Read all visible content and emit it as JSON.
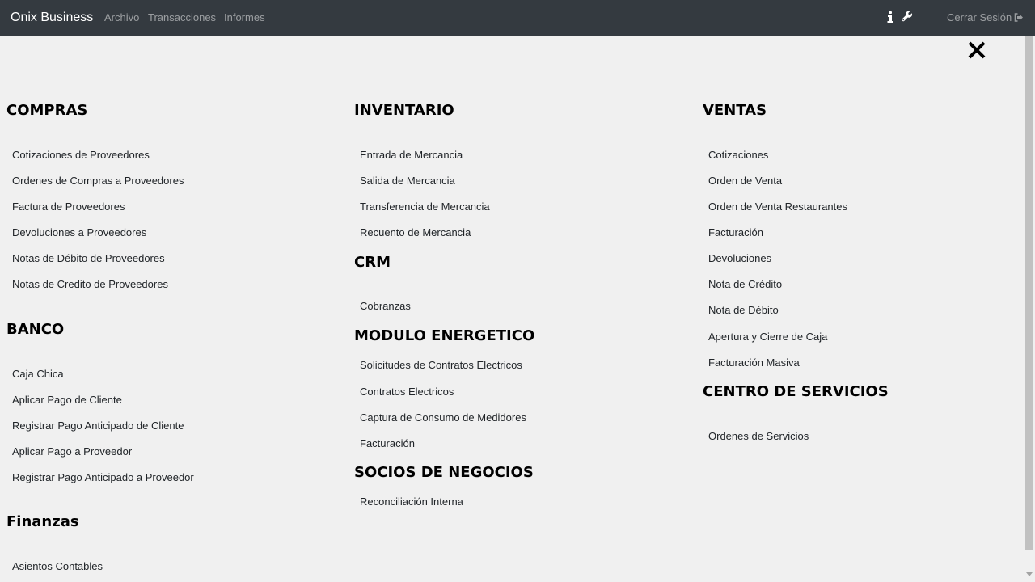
{
  "navbar": {
    "brand": "Onix Business",
    "links": [
      "Archivo",
      "Transacciones",
      "Informes"
    ],
    "info_icon": "info-icon",
    "settings_icon": "wrench-icon",
    "logout_label": "Cerrar Sesión",
    "logout_icon": "sign-out-icon",
    "background": "#343a40"
  },
  "close_icon": "close-icon",
  "sections": {
    "compras": {
      "title": "COMPRAS",
      "items": [
        "Cotizaciones de Proveedores",
        "Ordenes de Compras a Proveedores",
        "Factura de Proveedores",
        "Devoluciones a Proveedores",
        "Notas de Débito de Proveedores",
        "Notas de Credito de Proveedores"
      ]
    },
    "banco": {
      "title": "BANCO",
      "items": [
        "Caja Chica",
        "Aplicar Pago de Cliente",
        "Registrar Pago Anticipado de Cliente",
        "Aplicar Pago a Proveedor",
        "Registrar Pago Anticipado a Proveedor"
      ]
    },
    "finanzas": {
      "title": "Finanzas",
      "items": [
        "Asientos Contables"
      ]
    },
    "inventario": {
      "title": "INVENTARIO",
      "items": [
        "Entrada de Mercancia",
        "Salida de Mercancia",
        "Transferencia de Mercancia",
        "Recuento de Mercancia"
      ]
    },
    "crm": {
      "title": "CRM",
      "items": [
        "Cobranzas"
      ]
    },
    "modulo_energetico": {
      "title": "MODULO ENERGETICO",
      "items": [
        "Solicitudes de Contratos Electricos",
        "Contratos Electricos",
        "Captura de Consumo de Medidores",
        "Facturación"
      ]
    },
    "socios": {
      "title": "SOCIOS DE NEGOCIOS",
      "items": [
        "Reconciliación Interna"
      ]
    },
    "ventas": {
      "title": "VENTAS",
      "items": [
        "Cotizaciones",
        "Orden de Venta",
        "Orden de Venta Restaurantes",
        "Facturación",
        "Devoluciones",
        "Nota de Crédito",
        "Nota de Débito",
        "Apertura y Cierre de Caja",
        "Facturación Masiva"
      ]
    },
    "centro_servicios": {
      "title": "CENTRO DE SERVICIOS",
      "items": [
        "Ordenes de Servicios"
      ]
    }
  }
}
